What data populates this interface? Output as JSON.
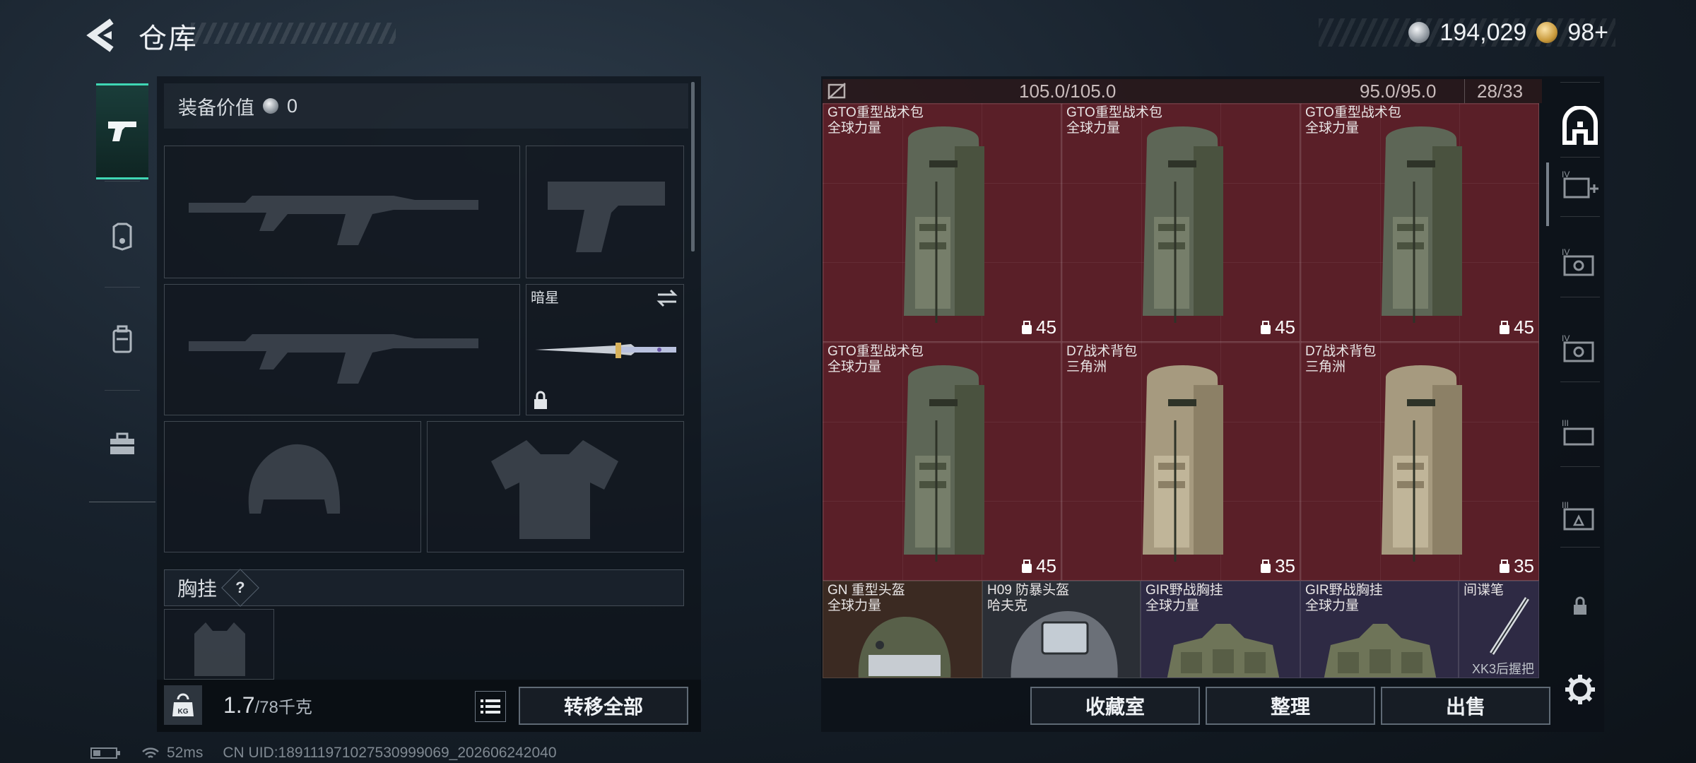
{
  "header": {
    "title": "仓库",
    "currency_silver": "194,029",
    "currency_gold": "98+"
  },
  "left_tabs": [
    {
      "icon": "pistol-icon",
      "active": true
    },
    {
      "icon": "armor-plate-icon",
      "active": false
    },
    {
      "icon": "backpack-icon",
      "active": false
    },
    {
      "icon": "toolbox-icon",
      "active": false
    }
  ],
  "loadout": {
    "equip_value_label": "装备价值",
    "equip_value": "0",
    "melee_name": "暗星",
    "chest_rig_label": "胸挂",
    "help_label": "?",
    "weight_value": "1.7",
    "weight_capacity": "/78千克",
    "kg_label": "KG",
    "transfer_all_label": "转移全部"
  },
  "storage": {
    "capacity_a": "105.0/105.0",
    "capacity_b": "95.0/95.0",
    "slots": "28/33",
    "items": [
      {
        "name": "GTO重型战术包",
        "sub": "全球力量",
        "cap": "45",
        "color": "red",
        "kind": "backpack-green"
      },
      {
        "name": "GTO重型战术包",
        "sub": "全球力量",
        "cap": "45",
        "color": "red",
        "kind": "backpack-green"
      },
      {
        "name": "GTO重型战术包",
        "sub": "全球力量",
        "cap": "45",
        "color": "red",
        "kind": "backpack-green"
      },
      {
        "name": "GTO重型战术包",
        "sub": "全球力量",
        "cap": "45",
        "color": "red",
        "kind": "backpack-green"
      },
      {
        "name": "D7战术背包",
        "sub": "三角洲",
        "cap": "35",
        "color": "red",
        "kind": "backpack-tan"
      },
      {
        "name": "D7战术背包",
        "sub": "三角洲",
        "cap": "35",
        "color": "red",
        "kind": "backpack-tan"
      }
    ],
    "bottom_items": [
      {
        "name": "GN 重型头盔",
        "sub": "全球力量",
        "color": "brown",
        "kind": "helmet"
      },
      {
        "name": "H09 防暴头盔",
        "sub": "哈夫克",
        "color": "gray",
        "kind": "helmet"
      },
      {
        "name": "GIR野战胸挂",
        "sub": "全球力量",
        "color": "purple",
        "kind": "rig"
      },
      {
        "name": "GIR野战胸挂",
        "sub": "全球力量",
        "color": "purple",
        "kind": "rig"
      },
      {
        "name": "间谍笔",
        "sub": "",
        "foot": "XK3后握把",
        "color": "purple",
        "kind": "pen"
      }
    ],
    "buttons": {
      "collection": "收藏室",
      "organize": "整理",
      "sell": "出售"
    }
  },
  "right_rail": [
    {
      "icon": "safehouse-icon"
    },
    {
      "icon": "add-case-icon"
    },
    {
      "icon": "case-iv-icon"
    },
    {
      "icon": "case-iv-b-icon"
    },
    {
      "icon": "case-iii-icon"
    },
    {
      "icon": "case-iii-b-icon"
    },
    {
      "icon": "lock-icon"
    },
    {
      "icon": "gear-icon"
    }
  ],
  "status": {
    "latency": "52ms",
    "uid": "CN UID:18911197102753099906​9_202606242040"
  }
}
